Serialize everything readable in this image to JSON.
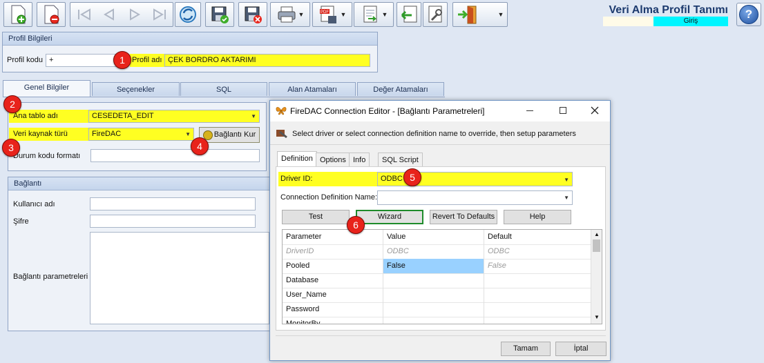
{
  "app": {
    "title": "Veri Alma Profil Tanımı",
    "status_right": "Giriş"
  },
  "toolbar": {
    "icons": [
      "new-document-icon",
      "delete-document-icon",
      "first-record-icon",
      "prev-record-icon",
      "next-record-icon",
      "last-record-icon",
      "refresh-icon",
      "save-icon",
      "save-cancel-icon",
      "print-icon",
      "pdf-export-icon",
      "export-icon",
      "import-icon",
      "settings-icon",
      "exit-icon"
    ]
  },
  "profile": {
    "section_title": "Profil Bilgileri",
    "code_label": "Profil kodu",
    "code_value": "+",
    "name_label": "Profil adı",
    "name_value": "ÇEK BORDRO AKTARIMI"
  },
  "tabs": [
    "Genel Bilgiler",
    "Seçenekler",
    "SQL",
    "Alan Atamaları",
    "Değer Atamaları"
  ],
  "general": {
    "table_label": "Ana tablo adı",
    "table_value": "CESEDETA_EDIT",
    "source_label": "Veri kaynak türü",
    "source_value": "FireDAC",
    "connect_button": "Bağlantı Kur",
    "status_label": "Durum kodu formatı",
    "status_value": ""
  },
  "connection": {
    "section_title": "Bağlantı",
    "user_label": "Kullanıcı adı",
    "password_label": "Şifre",
    "params_label": "Bağlantı parametreleri"
  },
  "badges": [
    "1",
    "2",
    "3",
    "4",
    "5",
    "6"
  ],
  "dialog": {
    "title": "FireDAC Connection Editor - [Bağlantı Parametreleri]",
    "instruction": "Select driver or select connection definition name to override, then setup parameters",
    "tabs": [
      "Definition",
      "Options",
      "Info",
      "SQL Script"
    ],
    "driver_label": "Driver ID:",
    "driver_value": "ODBC",
    "conn_def_label": "Connection Definition Name:",
    "conn_def_value": "",
    "buttons": {
      "test": "Test",
      "wizard": "Wizard",
      "revert": "Revert To Defaults",
      "help": "Help"
    },
    "grid": {
      "headers": [
        "Parameter",
        "Value",
        "Default"
      ],
      "rows": [
        {
          "param": "DriverID",
          "value": "ODBC",
          "default": "ODBC"
        },
        {
          "param": "Pooled",
          "value": "False",
          "default": "False"
        },
        {
          "param": "Database",
          "value": "",
          "default": ""
        },
        {
          "param": "User_Name",
          "value": "",
          "default": ""
        },
        {
          "param": "Password",
          "value": "",
          "default": ""
        },
        {
          "param": "MonitorBy",
          "value": "",
          "default": ""
        }
      ]
    },
    "ok": "Tamam",
    "cancel": "İptal"
  },
  "colors": {
    "highlight": "#ffff22",
    "badge": "#e8231b",
    "status_cyan": "#00f5ff",
    "selected_cell": "#99d1ff"
  }
}
